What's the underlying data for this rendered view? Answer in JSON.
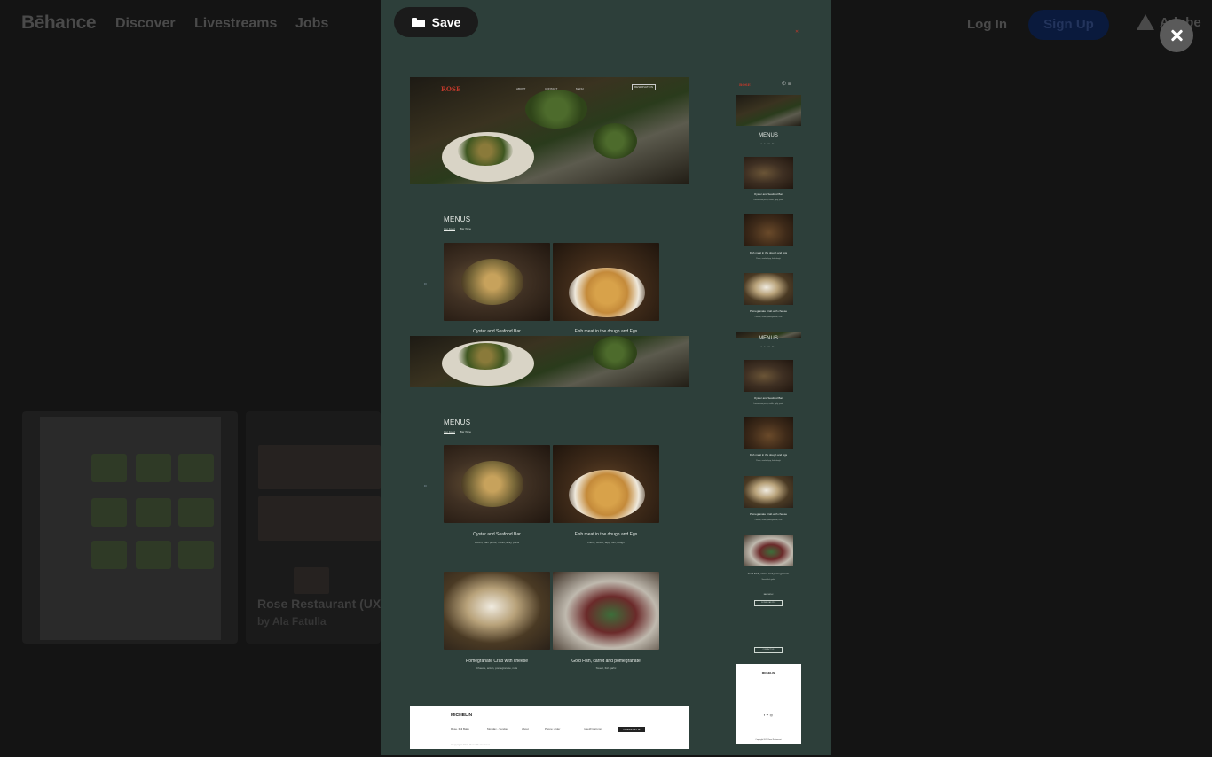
{
  "background": {
    "logo": "Bēhance",
    "nav": [
      "Discover",
      "Livestreams",
      "Jobs"
    ],
    "login": "Log In",
    "signup": "Sign Up",
    "adobe": "Adobe",
    "cards": [
      {
        "title": "Rose Restaurant (UX/UI)",
        "author": "by Ala Fatulla"
      }
    ]
  },
  "modal": {
    "save_label": "Save",
    "desktop": {
      "hero_logo": "ROSE",
      "hero_nav": [
        "ABOUT",
        "CONTACT",
        "MENU"
      ],
      "hero_reserve": "RESERVATION",
      "menus_title": "MENUS",
      "tabs": [
        "Our Food",
        "Bar Wine"
      ],
      "dishes": [
        {
          "name": "Oyster and Seafood Bar",
          "desc": "Lorem, nam purus, mollis, aptly, porta"
        },
        {
          "name": "Fish meat in the dough and Egs",
          "desc": "Pierre, omelo, lapp, fish, dough"
        },
        {
          "name": "Pomegranate Crab with cheese",
          "desc": "Cheese, anton, pomegranate, nuts"
        },
        {
          "name": "Gold Fish, carrot and pomegranate",
          "desc": "Sweet, fish garlic"
        }
      ],
      "footer": {
        "brand": "MICHELIN",
        "address": "Rose, Ilnil Baku",
        "hours": "Monday - Sunday",
        "links": "About",
        "phone": "Phone: order",
        "email": "rose@mail.com",
        "cta": "CONTACT US",
        "copyright": "Copyright 2021 Rose Restaurant"
      }
    },
    "mobile": {
      "logo": "ROSE",
      "menus_title": "MENUS",
      "tabs": "Our Food   Bar Wine",
      "dishes": [
        {
          "name": "Oyster and Seafood Bar",
          "desc": "Lorem, nam purus, mollis, aptly, porta"
        },
        {
          "name": "Fish meat in the dough and Egs",
          "desc": "Pierre, omelo, lapp, fish, dough"
        },
        {
          "name": "Pomegranate Crab with cheese",
          "desc": "Cheese, anton, pomegranate, nuts"
        },
        {
          "name": "Gold Fish, carrot and pomegranate",
          "desc": "Sweet, fish garlic"
        }
      ],
      "bar_menu": "BAR MENU",
      "download": "DOWNLOAD PDF",
      "contact_btn": "CONTACT US",
      "footer_brand": "MICHELIN",
      "copyright": "Copyright 2021 Rose Restaurant"
    }
  }
}
